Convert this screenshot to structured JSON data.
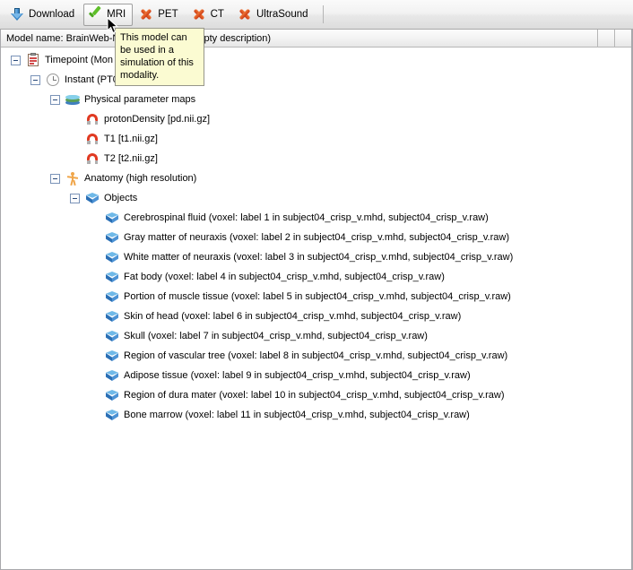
{
  "toolbar": {
    "buttons": [
      {
        "label": "Download",
        "icon": "download-arrow-icon",
        "state": "normal"
      },
      {
        "label": "MRI",
        "icon": "green-check-icon",
        "state": "selected"
      },
      {
        "label": "PET",
        "icon": "red-x-icon",
        "state": "normal"
      },
      {
        "label": "CT",
        "icon": "red-x-icon",
        "state": "normal"
      },
      {
        "label": "UltraSound",
        "icon": "red-x-icon",
        "state": "normal"
      }
    ]
  },
  "tooltip": {
    "text": "This model can be used in a simulation of this modality."
  },
  "header": {
    "model_name": "Model name: BrainWeb-Normal-...-maps (Empty description)"
  },
  "tree": {
    "rows": [
      {
        "indent": 0,
        "toggle": "minus",
        "icon": "clipboard-icon",
        "label": "Timepoint (Mon Dec ... 100 2012)"
      },
      {
        "indent": 1,
        "toggle": "minus",
        "icon": "clock-icon",
        "label": "Instant (PT0S)"
      },
      {
        "indent": 2,
        "toggle": "minus",
        "icon": "layers-icon",
        "label": "Physical parameter maps"
      },
      {
        "indent": 3,
        "toggle": "none",
        "icon": "magnet-icon",
        "label": "protonDensity [pd.nii.gz]"
      },
      {
        "indent": 3,
        "toggle": "none",
        "icon": "magnet-icon",
        "label": "T1 [t1.nii.gz]"
      },
      {
        "indent": 3,
        "toggle": "none",
        "icon": "magnet-icon",
        "label": "T2 [t2.nii.gz]"
      },
      {
        "indent": 2,
        "toggle": "minus",
        "icon": "person-icon",
        "label": "Anatomy (high resolution)"
      },
      {
        "indent": 3,
        "toggle": "minus",
        "icon": "cube-icon",
        "label": "Objects"
      },
      {
        "indent": 4,
        "toggle": "none",
        "icon": "cube-icon",
        "label": "Cerebrospinal fluid (voxel: label 1 in subject04_crisp_v.mhd, subject04_crisp_v.raw)"
      },
      {
        "indent": 4,
        "toggle": "none",
        "icon": "cube-icon",
        "label": "Gray matter of neuraxis (voxel: label 2 in subject04_crisp_v.mhd, subject04_crisp_v.raw)"
      },
      {
        "indent": 4,
        "toggle": "none",
        "icon": "cube-icon",
        "label": "White matter of neuraxis (voxel: label 3 in subject04_crisp_v.mhd, subject04_crisp_v.raw)"
      },
      {
        "indent": 4,
        "toggle": "none",
        "icon": "cube-icon",
        "label": "Fat body (voxel: label 4 in subject04_crisp_v.mhd, subject04_crisp_v.raw)"
      },
      {
        "indent": 4,
        "toggle": "none",
        "icon": "cube-icon",
        "label": "Portion of muscle tissue (voxel: label 5 in subject04_crisp_v.mhd, subject04_crisp_v.raw)"
      },
      {
        "indent": 4,
        "toggle": "none",
        "icon": "cube-icon",
        "label": "Skin of head (voxel: label 6 in subject04_crisp_v.mhd, subject04_crisp_v.raw)"
      },
      {
        "indent": 4,
        "toggle": "none",
        "icon": "cube-icon",
        "label": "Skull (voxel: label 7 in subject04_crisp_v.mhd, subject04_crisp_v.raw)"
      },
      {
        "indent": 4,
        "toggle": "none",
        "icon": "cube-icon",
        "label": "Region of vascular tree (voxel: label 8 in subject04_crisp_v.mhd, subject04_crisp_v.raw)"
      },
      {
        "indent": 4,
        "toggle": "none",
        "icon": "cube-icon",
        "label": "Adipose tissue (voxel: label 9 in subject04_crisp_v.mhd, subject04_crisp_v.raw)"
      },
      {
        "indent": 4,
        "toggle": "none",
        "icon": "cube-icon",
        "label": "Region of dura mater (voxel: label 10 in subject04_crisp_v.mhd, subject04_crisp_v.raw)"
      },
      {
        "indent": 4,
        "toggle": "none",
        "icon": "cube-icon",
        "label": "Bone marrow (voxel: label 11 in subject04_crisp_v.mhd, subject04_crisp_v.raw)"
      }
    ]
  },
  "colors": {
    "tooltip_bg": "#fbfbd2",
    "selected_border": "#a0a0a0",
    "check_green": "#5fbf2a",
    "x_red": "#cc3a12",
    "magnet_red": "#e03a22",
    "cube_blue": "#4c92d4"
  }
}
